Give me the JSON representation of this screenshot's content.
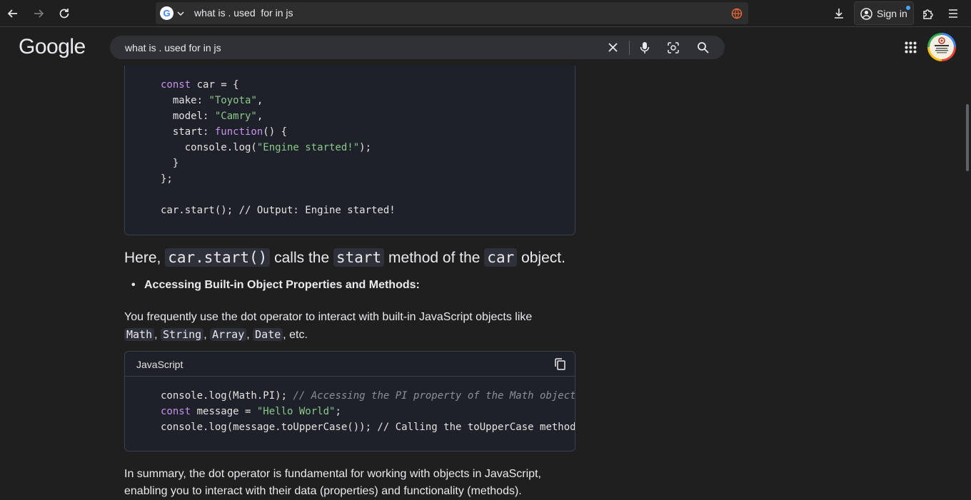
{
  "browser": {
    "url": "what is . used  for in js",
    "sign_in_label": "Sign in"
  },
  "google": {
    "logo_text": "Google",
    "search_query": "what is . used for in js"
  },
  "content": {
    "code1": {
      "lines": [
        {
          "parts": [
            [
              "kw",
              "const"
            ],
            [
              "p",
              " car = {"
            ]
          ]
        },
        {
          "parts": [
            [
              "p",
              "  make: "
            ],
            [
              "str",
              "\"Toyota\""
            ],
            [
              "p",
              ","
            ]
          ]
        },
        {
          "parts": [
            [
              "p",
              "  model: "
            ],
            [
              "str",
              "\"Camry\""
            ],
            [
              "p",
              ","
            ]
          ]
        },
        {
          "parts": [
            [
              "p",
              "  start: "
            ],
            [
              "kw",
              "function"
            ],
            [
              "p",
              "() {"
            ]
          ]
        },
        {
          "parts": [
            [
              "p",
              "    console.log("
            ],
            [
              "str",
              "\"Engine started!\""
            ],
            [
              "p",
              ");"
            ]
          ]
        },
        {
          "parts": [
            [
              "p",
              "  }"
            ]
          ]
        },
        {
          "parts": [
            [
              "p",
              "};"
            ]
          ]
        },
        {
          "parts": [
            [
              "p",
              ""
            ]
          ]
        },
        {
          "parts": [
            [
              "p",
              "car.start(); // Output: Engine started!"
            ]
          ]
        }
      ]
    },
    "heading": {
      "pre": "Here, ",
      "code1": "car.start()",
      "mid1": " calls the ",
      "code2": "start",
      "mid2": " method of the ",
      "code3": "car",
      "post": " object."
    },
    "bullet": "Accessing Built-in Object Properties and Methods:",
    "para1": {
      "text": "You frequently use the dot operator to interact with built-in JavaScript objects like",
      "codes": [
        "Math",
        "String",
        "Array",
        "Date"
      ],
      "post": ", etc."
    },
    "code2": {
      "language": "JavaScript",
      "lines": [
        {
          "parts": [
            [
              "p",
              "console.log(Math.PI); "
            ],
            [
              "cmt",
              "// Accessing the PI property of the Math object"
            ]
          ]
        },
        {
          "parts": [
            [
              "kw",
              "const"
            ],
            [
              "p",
              " message = "
            ],
            [
              "str",
              "\"Hello World\""
            ],
            [
              "p",
              ";"
            ]
          ]
        },
        {
          "parts": [
            [
              "p",
              "console.log(message.toUpperCase()); // Calling the toUpperCase method"
            ]
          ]
        }
      ]
    },
    "summary": "In summary, the dot operator is fundamental for working with objects in JavaScript,",
    "summary2": "enabling you to interact with their data (properties) and functionality (methods)."
  },
  "colors": {
    "background": "#1f1f1f",
    "code_bg": "#1e2129",
    "keyword": "#c792ea",
    "string": "#8bc98b"
  }
}
